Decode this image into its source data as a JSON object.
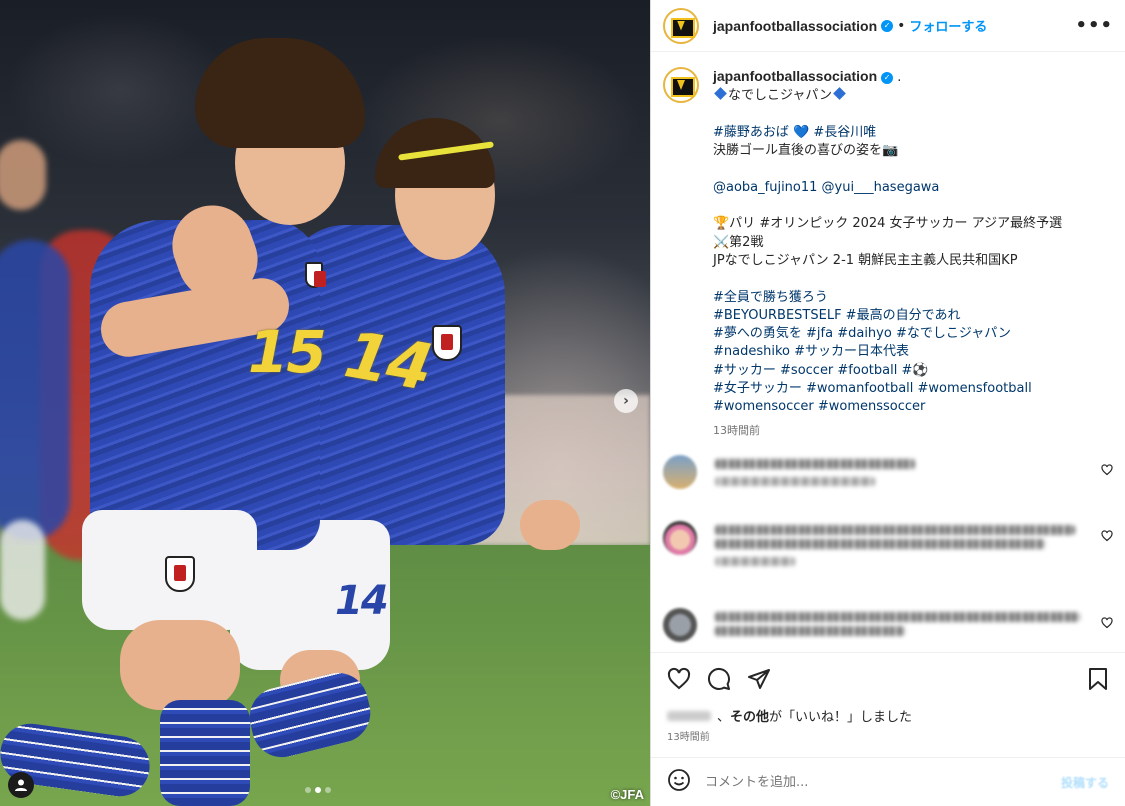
{
  "photo": {
    "copyright": "©JFA",
    "player1_number": "15",
    "player2_number": "14",
    "shorts_number": "14",
    "carousel_next": "›",
    "carousel_dots": 3,
    "active_dot": 1
  },
  "header": {
    "username": "japanfootballassociation",
    "follow_label": "フォローする",
    "separator": "•",
    "more_label": "•••"
  },
  "caption": {
    "username": "japanfootballassociation",
    "dot": ".",
    "title": "なでしこジャパン",
    "line_hashtags1": "#藤野あおば 💙 #長谷川唯",
    "line_text1": "決勝ゴール直後の喜びの姿を📷",
    "line_mentions": "@aoba_fujino11 @yui___hasegawa",
    "line_event": "🏆パリ #オリンピック 2024 女子サッカー アジア最終予選",
    "line_round": "⚔️第2戦",
    "line_score": "JPなでしこジャパン 2-1 朝鮮民主主義人民共和国KP",
    "tags": [
      "#全員で勝ち獲ろう",
      "#BEYOURBESTSELF #最高の自分であれ",
      "#夢への勇気を #jfa #daihyo #なでしこジャパン",
      "#nadeshiko #サッカー日本代表",
      "#サッカー #soccer #football #⚽",
      "#女子サッカー #womanfootball #womensfootball",
      "#womensoccer #womenssoccer"
    ],
    "time": "13時間前"
  },
  "actions": {
    "liked_by_suffix": "、",
    "liked_by_others": "その他",
    "liked_by_tail": "が「いいね！」しました",
    "post_time": "13時間前"
  },
  "comment_box": {
    "placeholder": "コメントを追加...",
    "post_label": "投稿する"
  },
  "colors": {
    "link": "#00376b",
    "accent": "#0095f6",
    "muted": "#737373"
  }
}
